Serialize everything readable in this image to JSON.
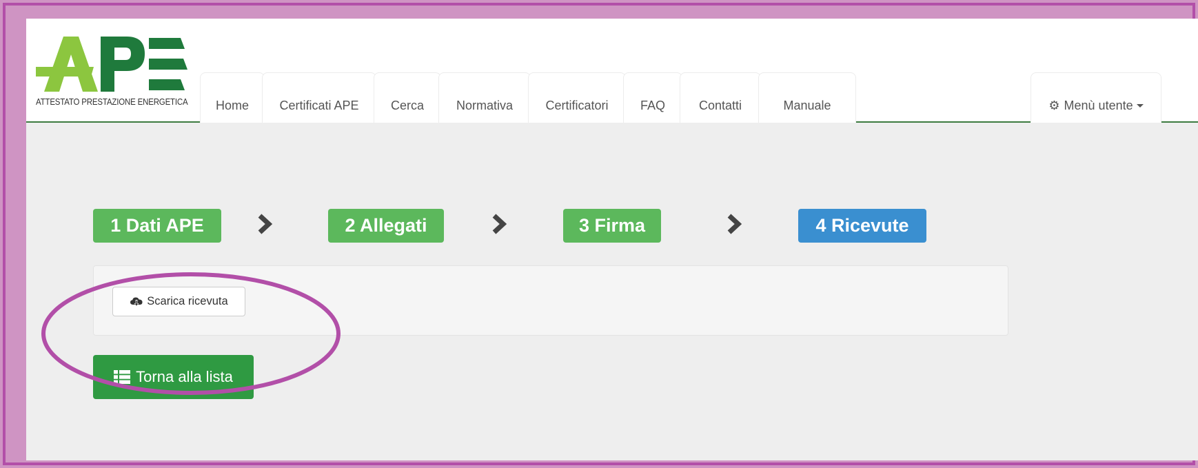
{
  "logo": {
    "text": "APE",
    "caption": "ATTESTATO PRESTAZIONE ENERGETICA",
    "color_light": "#8cc63f",
    "color_dark": "#1f7a3c"
  },
  "nav": {
    "tabs": [
      {
        "label": "Home"
      },
      {
        "label": "Certificati APE"
      },
      {
        "label": "Cerca"
      },
      {
        "label": "Normativa"
      },
      {
        "label": "Certificatori"
      },
      {
        "label": "FAQ"
      },
      {
        "label": "Contatti"
      },
      {
        "label": "Manuale"
      }
    ],
    "user_menu": {
      "label": "Menù utente",
      "icon": "gear-icon"
    }
  },
  "steps": [
    {
      "label": "1 Dati APE",
      "state": "done",
      "color": "#5cb85c"
    },
    {
      "label": "2 Allegati",
      "state": "done",
      "color": "#5cb85c"
    },
    {
      "label": "3 Firma",
      "state": "done",
      "color": "#5cb85c"
    },
    {
      "label": "4 Ricevute",
      "state": "current",
      "color": "#3a8fd0"
    }
  ],
  "receipt_panel": {
    "download_button": {
      "label": "Scarica ricevuta",
      "icon": "cloud-download-icon"
    }
  },
  "back_button": {
    "label": "Torna alla lista",
    "icon": "list-icon",
    "color": "#2f9a42"
  },
  "annotation": {
    "ring_color": "#b24fa8"
  }
}
